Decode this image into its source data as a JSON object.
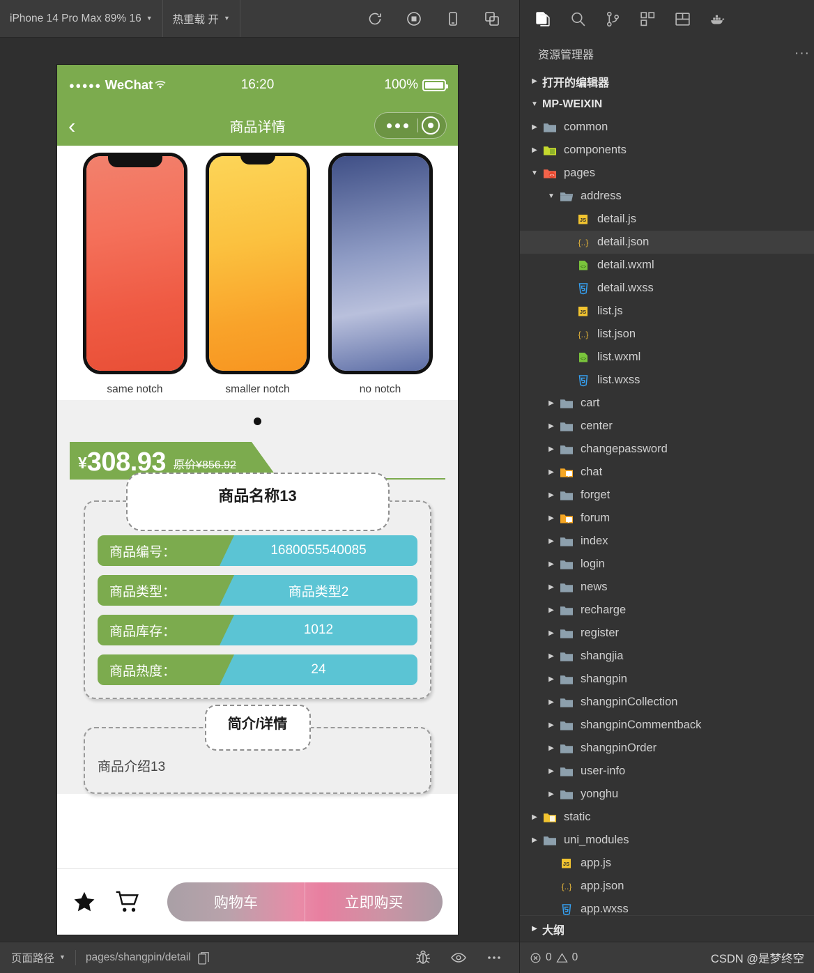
{
  "simulator": {
    "toolbar": {
      "device_label": "iPhone 14 Pro Max 89% 16",
      "hotreload_label": "热重载 开",
      "icons": [
        {
          "name": "refresh-icon"
        },
        {
          "name": "stop-icon"
        },
        {
          "name": "device-icon"
        },
        {
          "name": "multiwindow-icon"
        }
      ]
    },
    "statusbar": {
      "page_path_label": "页面路径",
      "page_path_value": "pages/shangpin/detail",
      "icons": [
        {
          "name": "debug-bug-icon"
        },
        {
          "name": "eye-icon"
        },
        {
          "name": "more-icon"
        }
      ]
    }
  },
  "phone": {
    "status": {
      "signal_dots": "●●●●●",
      "carrier": "WeChat",
      "time": "16:20",
      "battery_percent": "100%"
    },
    "navbar": {
      "title": "商品详情",
      "back_icon": "chevron-left-icon"
    },
    "carousel": {
      "slides": [
        {
          "label": "same notch"
        },
        {
          "label": "smaller notch"
        },
        {
          "label": "no notch"
        }
      ]
    },
    "price": {
      "currency": "¥",
      "current": "308.93",
      "original_label": "原价",
      "original_currency": "¥",
      "original": "856.92"
    },
    "product": {
      "name": "商品名称13",
      "rows": [
        {
          "key": "商品编号：",
          "value": "1680055540085"
        },
        {
          "key": "商品类型：",
          "value": "商品类型2"
        },
        {
          "key": "商品库存：",
          "value": "1012"
        },
        {
          "key": "商品热度：",
          "value": "24"
        }
      ]
    },
    "description": {
      "title": "简介/详情",
      "body": "商品介绍13"
    },
    "tabbar": {
      "star_icon": "star-icon",
      "cart_icon": "cart-icon",
      "cart_label": "购物车",
      "buy_label": "立即购买"
    },
    "colors": {
      "wechat_green": "#7cab4e",
      "info_teal": "#5bc4d4",
      "buy_pink": "#e98ba7"
    }
  },
  "vscode": {
    "activity_icons": [
      {
        "name": "explorer-icon",
        "active": true
      },
      {
        "name": "search-icon",
        "active": false
      },
      {
        "name": "source-control-icon",
        "active": false
      },
      {
        "name": "extensions-icon",
        "active": false
      },
      {
        "name": "layout-icon",
        "active": false
      },
      {
        "name": "docker-icon",
        "active": false
      }
    ],
    "panel_title": "资源管理器",
    "panel_more": "···",
    "open_editors_label": "打开的编辑器",
    "project_label": "MP-WEIXIN",
    "outline_label": "大纲",
    "tree": [
      {
        "label": "common",
        "kind": "folder",
        "indent": 1,
        "twisty": "collapsed",
        "selected": false
      },
      {
        "label": "components",
        "kind": "folder-green",
        "indent": 1,
        "twisty": "collapsed",
        "selected": false
      },
      {
        "label": "pages",
        "kind": "folder-red",
        "indent": 1,
        "twisty": "expanded",
        "selected": false
      },
      {
        "label": "address",
        "kind": "folder-open",
        "indent": 2,
        "twisty": "expanded",
        "selected": false
      },
      {
        "label": "detail.js",
        "kind": "js",
        "indent": 3,
        "twisty": "none",
        "selected": false
      },
      {
        "label": "detail.json",
        "kind": "json",
        "indent": 3,
        "twisty": "none",
        "selected": true
      },
      {
        "label": "detail.wxml",
        "kind": "wxml",
        "indent": 3,
        "twisty": "none",
        "selected": false
      },
      {
        "label": "detail.wxss",
        "kind": "wxss",
        "indent": 3,
        "twisty": "none",
        "selected": false
      },
      {
        "label": "list.js",
        "kind": "js",
        "indent": 3,
        "twisty": "none",
        "selected": false
      },
      {
        "label": "list.json",
        "kind": "json",
        "indent": 3,
        "twisty": "none",
        "selected": false
      },
      {
        "label": "list.wxml",
        "kind": "wxml",
        "indent": 3,
        "twisty": "none",
        "selected": false
      },
      {
        "label": "list.wxss",
        "kind": "wxss",
        "indent": 3,
        "twisty": "none",
        "selected": false
      },
      {
        "label": "cart",
        "kind": "folder",
        "indent": 2,
        "twisty": "collapsed",
        "selected": false
      },
      {
        "label": "center",
        "kind": "folder",
        "indent": 2,
        "twisty": "collapsed",
        "selected": false
      },
      {
        "label": "changepassword",
        "kind": "folder",
        "indent": 2,
        "twisty": "collapsed",
        "selected": false
      },
      {
        "label": "chat",
        "kind": "folder-chat",
        "indent": 2,
        "twisty": "collapsed",
        "selected": false
      },
      {
        "label": "forget",
        "kind": "folder",
        "indent": 2,
        "twisty": "collapsed",
        "selected": false
      },
      {
        "label": "forum",
        "kind": "folder-chat",
        "indent": 2,
        "twisty": "collapsed",
        "selected": false
      },
      {
        "label": "index",
        "kind": "folder",
        "indent": 2,
        "twisty": "collapsed",
        "selected": false
      },
      {
        "label": "login",
        "kind": "folder",
        "indent": 2,
        "twisty": "collapsed",
        "selected": false
      },
      {
        "label": "news",
        "kind": "folder",
        "indent": 2,
        "twisty": "collapsed",
        "selected": false
      },
      {
        "label": "recharge",
        "kind": "folder",
        "indent": 2,
        "twisty": "collapsed",
        "selected": false
      },
      {
        "label": "register",
        "kind": "folder",
        "indent": 2,
        "twisty": "collapsed",
        "selected": false
      },
      {
        "label": "shangjia",
        "kind": "folder",
        "indent": 2,
        "twisty": "collapsed",
        "selected": false
      },
      {
        "label": "shangpin",
        "kind": "folder",
        "indent": 2,
        "twisty": "collapsed",
        "selected": false
      },
      {
        "label": "shangpinCollection",
        "kind": "folder",
        "indent": 2,
        "twisty": "collapsed",
        "selected": false
      },
      {
        "label": "shangpinCommentback",
        "kind": "folder",
        "indent": 2,
        "twisty": "collapsed",
        "selected": false
      },
      {
        "label": "shangpinOrder",
        "kind": "folder",
        "indent": 2,
        "twisty": "collapsed",
        "selected": false
      },
      {
        "label": "user-info",
        "kind": "folder",
        "indent": 2,
        "twisty": "collapsed",
        "selected": false
      },
      {
        "label": "yonghu",
        "kind": "folder",
        "indent": 2,
        "twisty": "collapsed",
        "selected": false
      },
      {
        "label": "static",
        "kind": "folder-static",
        "indent": 1,
        "twisty": "collapsed",
        "selected": false
      },
      {
        "label": "uni_modules",
        "kind": "folder",
        "indent": 1,
        "twisty": "collapsed",
        "selected": false
      },
      {
        "label": "app.js",
        "kind": "js",
        "indent": 2,
        "twisty": "none",
        "selected": false
      },
      {
        "label": "app.json",
        "kind": "json",
        "indent": 2,
        "twisty": "none",
        "selected": false
      },
      {
        "label": "app.wxss",
        "kind": "wxss",
        "indent": 2,
        "twisty": "none",
        "selected": false
      }
    ],
    "status": {
      "errors": "0",
      "warnings": "0",
      "watermark": "CSDN @是梦终空"
    }
  }
}
